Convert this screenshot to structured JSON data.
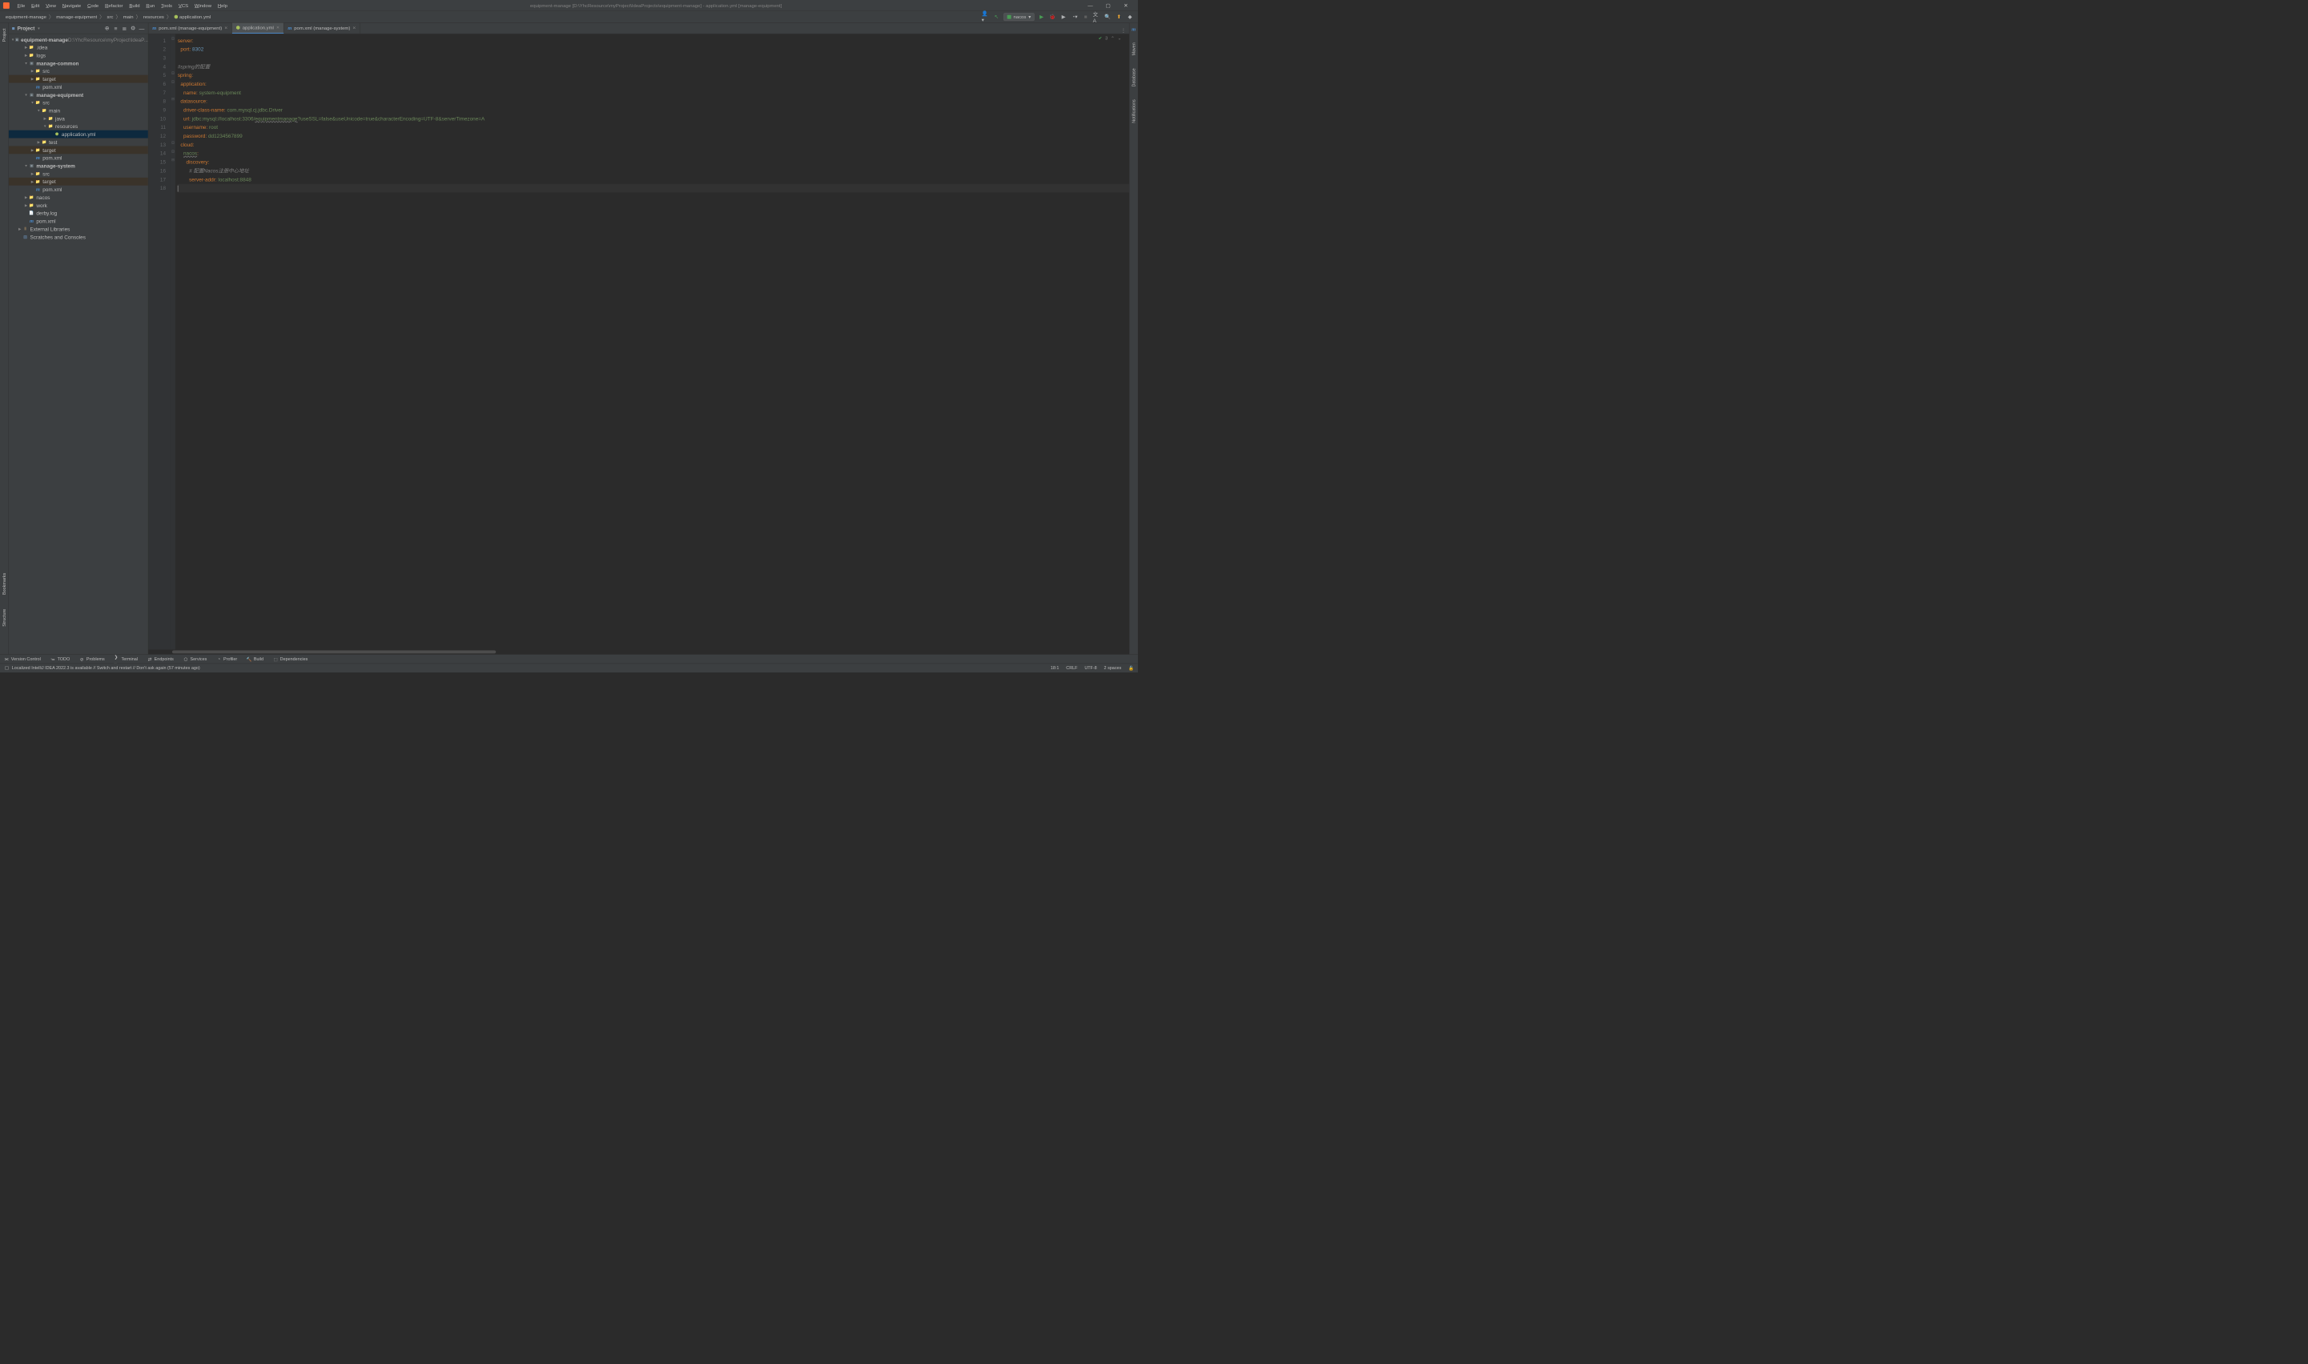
{
  "menu": [
    "File",
    "Edit",
    "View",
    "Navigate",
    "Code",
    "Refactor",
    "Build",
    "Run",
    "Tools",
    "VCS",
    "Window",
    "Help"
  ],
  "title": "equipment-manage [D:\\YhcResource\\myProject\\IdeaProjects\\equipment-manage] - application.yml [manage-equipment]",
  "breadcrumb": [
    "equipment-manage",
    "manage-equipment",
    "src",
    "main",
    "resources",
    "application.yml"
  ],
  "run_config": "nacos",
  "project_panel": {
    "title": "Project"
  },
  "tree": {
    "root": {
      "name": "equipment-manage",
      "path": "D:\\YhcResource\\myProject\\IdeaP..."
    },
    "items": [
      {
        "d": 1,
        "a": ">",
        "i": "folder",
        "n": ".idea"
      },
      {
        "d": 1,
        "a": ">",
        "i": "folder",
        "n": "logs"
      },
      {
        "d": 1,
        "a": "v",
        "i": "module",
        "n": "manage-common",
        "bold": true
      },
      {
        "d": 2,
        "a": ">",
        "i": "folder-b",
        "n": "src"
      },
      {
        "d": 2,
        "a": ">",
        "i": "folder-y",
        "n": "target",
        "hl": "t"
      },
      {
        "d": 2,
        "a": "",
        "i": "maven",
        "n": "pom.xml"
      },
      {
        "d": 1,
        "a": "v",
        "i": "module",
        "n": "manage-equipment",
        "bold": true
      },
      {
        "d": 2,
        "a": "v",
        "i": "folder-b",
        "n": "src"
      },
      {
        "d": 3,
        "a": "v",
        "i": "folder",
        "n": "main"
      },
      {
        "d": 4,
        "a": ">",
        "i": "folder-b",
        "n": "java"
      },
      {
        "d": 4,
        "a": "v",
        "i": "folder-y",
        "n": "resources"
      },
      {
        "d": 5,
        "a": "",
        "i": "yml",
        "n": "application.yml",
        "sel": true
      },
      {
        "d": 3,
        "a": ">",
        "i": "folder",
        "n": "test"
      },
      {
        "d": 2,
        "a": ">",
        "i": "folder-y",
        "n": "target",
        "hl": "t"
      },
      {
        "d": 2,
        "a": "",
        "i": "maven",
        "n": "pom.xml"
      },
      {
        "d": 1,
        "a": "v",
        "i": "module",
        "n": "manage-system",
        "bold": true
      },
      {
        "d": 2,
        "a": ">",
        "i": "folder-b",
        "n": "src"
      },
      {
        "d": 2,
        "a": ">",
        "i": "folder-y",
        "n": "target",
        "hl": "t"
      },
      {
        "d": 2,
        "a": "",
        "i": "maven",
        "n": "pom.xml"
      },
      {
        "d": 1,
        "a": ">",
        "i": "folder",
        "n": "nacos"
      },
      {
        "d": 1,
        "a": ">",
        "i": "folder",
        "n": "work"
      },
      {
        "d": 1,
        "a": "",
        "i": "file",
        "n": "derby.log"
      },
      {
        "d": 1,
        "a": "",
        "i": "maven",
        "n": "pom.xml"
      },
      {
        "d": 0,
        "a": ">",
        "i": "lib",
        "n": "External Libraries"
      },
      {
        "d": 0,
        "a": "",
        "i": "scratch",
        "n": "Scratches and Consoles"
      }
    ]
  },
  "tabs": [
    {
      "icon": "maven",
      "label": "pom.xml (manage-equipment)"
    },
    {
      "icon": "yml",
      "label": "application.yml",
      "active": true
    },
    {
      "icon": "maven",
      "label": "pom.xml (manage-system)"
    }
  ],
  "inspection_count": "3",
  "code_lines": [
    {
      "n": 1,
      "t": [
        [
          "k",
          "server"
        ],
        [
          "p",
          ":"
        ]
      ]
    },
    {
      "n": 2,
      "t": [
        [
          "",
          "  "
        ],
        [
          "k",
          "port"
        ],
        [
          "p",
          ": "
        ],
        [
          "n",
          "8302"
        ]
      ]
    },
    {
      "n": 3,
      "t": [
        [
          "",
          ""
        ]
      ]
    },
    {
      "n": 4,
      "t": [
        [
          "c",
          "#spring的配置"
        ]
      ]
    },
    {
      "n": 5,
      "t": [
        [
          "k",
          "spring"
        ],
        [
          "p",
          ":"
        ]
      ]
    },
    {
      "n": 6,
      "t": [
        [
          "",
          "  "
        ],
        [
          "k",
          "application"
        ],
        [
          "p",
          ":"
        ]
      ]
    },
    {
      "n": 7,
      "t": [
        [
          "",
          "    "
        ],
        [
          "k",
          "name"
        ],
        [
          "p",
          ": "
        ],
        [
          "s",
          "system-equipment"
        ]
      ]
    },
    {
      "n": 8,
      "t": [
        [
          "",
          "  "
        ],
        [
          "k",
          "datasource"
        ],
        [
          "p",
          ":"
        ]
      ]
    },
    {
      "n": 9,
      "t": [
        [
          "",
          "    "
        ],
        [
          "k",
          "driver-class-name"
        ],
        [
          "p",
          ": "
        ],
        [
          "s",
          "com.mysql.cj.jdbc.Driver"
        ]
      ]
    },
    {
      "n": 10,
      "t": [
        [
          "",
          "    "
        ],
        [
          "k",
          "url"
        ],
        [
          "p",
          ": "
        ],
        [
          "s",
          "jdbc:mysql://localhost:3306/"
        ],
        [
          "wave",
          "equipmentmanage"
        ],
        [
          "s",
          "?useSSL=false&useUnicode=true&characterEncoding=UTF-8&serverTimezone=A"
        ]
      ]
    },
    {
      "n": 11,
      "t": [
        [
          "",
          "    "
        ],
        [
          "k",
          "username"
        ],
        [
          "p",
          ": "
        ],
        [
          "s",
          "root"
        ]
      ]
    },
    {
      "n": 12,
      "t": [
        [
          "",
          "    "
        ],
        [
          "k",
          "password"
        ],
        [
          "p",
          ": "
        ],
        [
          "s",
          "dd1234567899"
        ]
      ]
    },
    {
      "n": 13,
      "t": [
        [
          "",
          "  "
        ],
        [
          "k",
          "cloud"
        ],
        [
          "p",
          ":"
        ]
      ]
    },
    {
      "n": 14,
      "t": [
        [
          "",
          "    "
        ],
        [
          "wave",
          "nacos"
        ],
        [
          "p",
          ":"
        ]
      ]
    },
    {
      "n": 15,
      "t": [
        [
          "",
          "      "
        ],
        [
          "k",
          "discovery"
        ],
        [
          "p",
          ":"
        ]
      ]
    },
    {
      "n": 16,
      "t": [
        [
          "",
          "        "
        ],
        [
          "c",
          "# 配置"
        ],
        [
          "c",
          "Nacos"
        ],
        [
          "c",
          "注册中心地址"
        ]
      ]
    },
    {
      "n": 17,
      "t": [
        [
          "",
          "        "
        ],
        [
          "k",
          "server-addr"
        ],
        [
          "p",
          ": "
        ],
        [
          "s",
          "localhost:8848"
        ]
      ]
    },
    {
      "n": 18,
      "t": [
        [
          "",
          ""
        ]
      ],
      "cur": true
    }
  ],
  "left_tools": [
    "Project",
    "Bookmarks",
    "Structure"
  ],
  "right_tools": [
    "Maven",
    "Database",
    "Notifications"
  ],
  "bottom_tools": [
    "Version Control",
    "TODO",
    "Problems",
    "Terminal",
    "Endpoints",
    "Services",
    "Profiler",
    "Build",
    "Dependencies"
  ],
  "status_msg": "Localized IntelliJ IDEA 2022.3 is available // Switch and restart // Don't ask again (57 minutes ago)",
  "status_right": {
    "pos": "18:1",
    "eol": "CRLF",
    "enc": "UTF-8",
    "indent": "2 spaces"
  }
}
